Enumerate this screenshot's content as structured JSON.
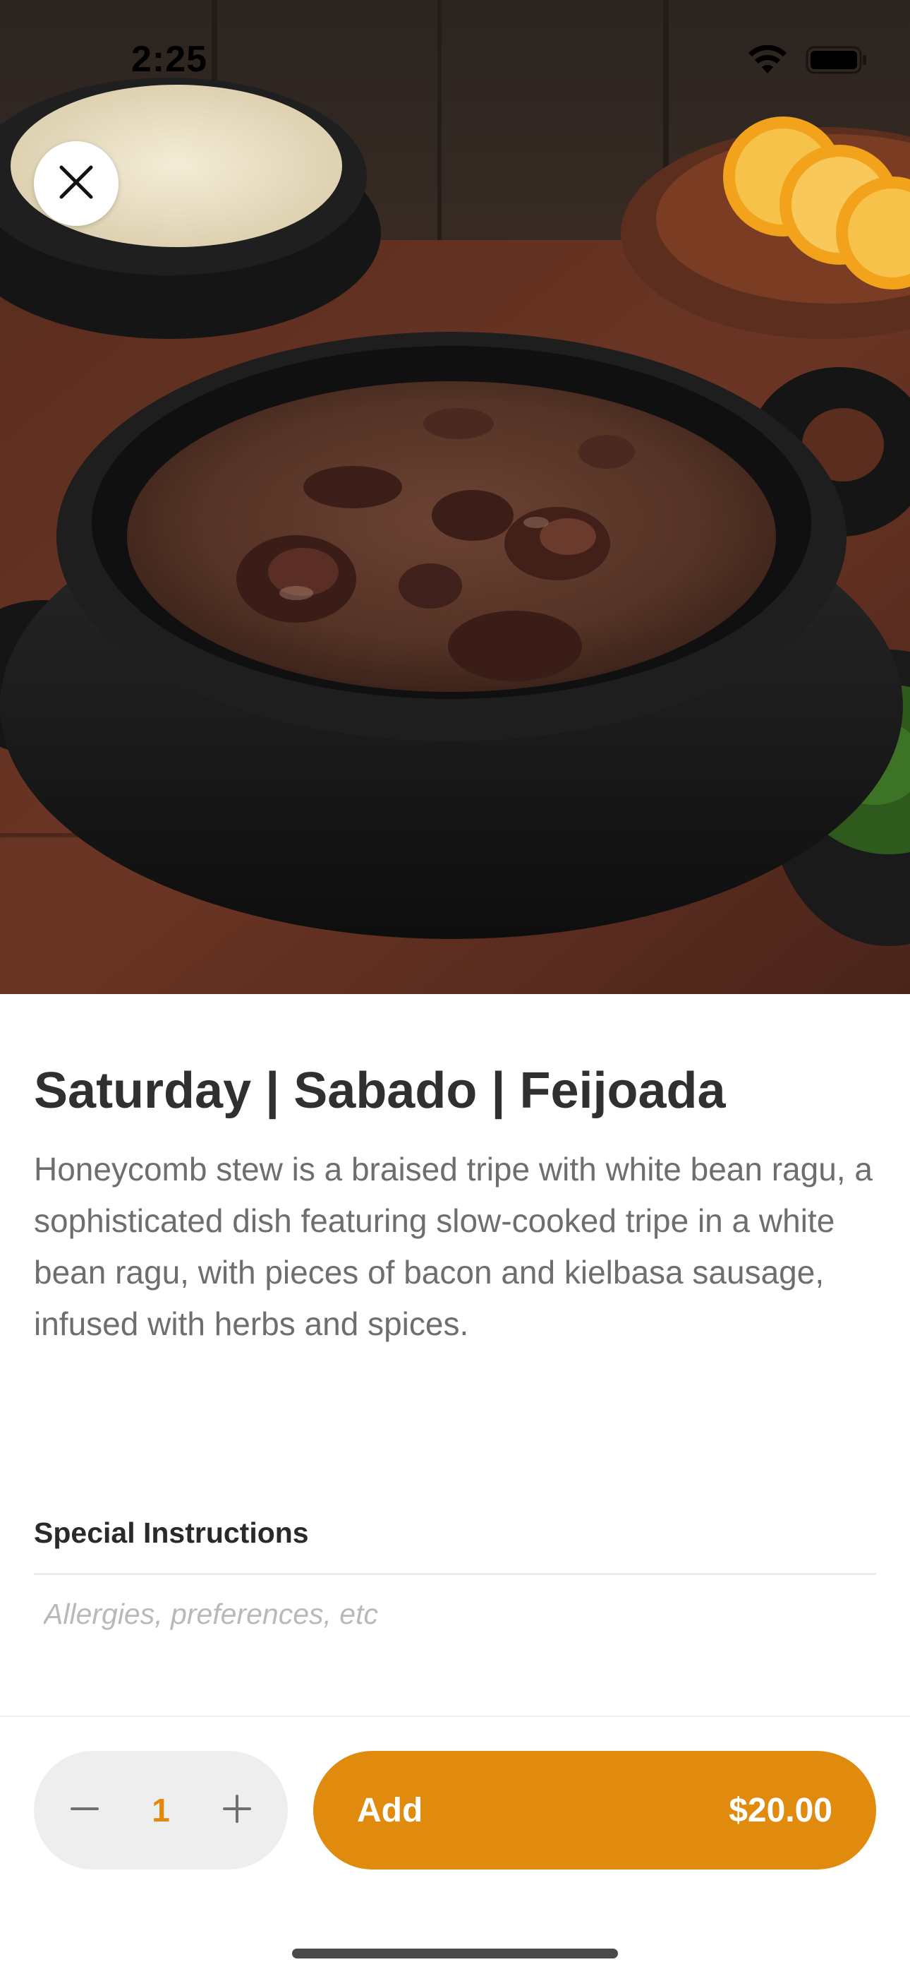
{
  "status_bar": {
    "time": "2:25",
    "icons": [
      "wifi-icon",
      "battery-icon"
    ]
  },
  "hero": {
    "image_subject": "bowl-of-feijoada-stew"
  },
  "close_button": {
    "icon": "close-icon"
  },
  "item": {
    "title": "Saturday | Sabado | Feijoada",
    "description": "Honeycomb stew is a braised tripe with white bean ragu, a sophisticated dish featuring slow-cooked tripe in a white bean ragu, with pieces of bacon and kielbasa sausage, infused with herbs and spices."
  },
  "special_instructions": {
    "label": "Special Instructions",
    "placeholder": "Allergies, preferences, etc",
    "value": ""
  },
  "order": {
    "quantity": "1",
    "add_label": "Add",
    "price": "$20.00"
  },
  "colors": {
    "accent": "#e08a0e",
    "stepper_bg": "#eeeeee",
    "title_text": "#303030",
    "body_text": "#6e6e6e"
  }
}
